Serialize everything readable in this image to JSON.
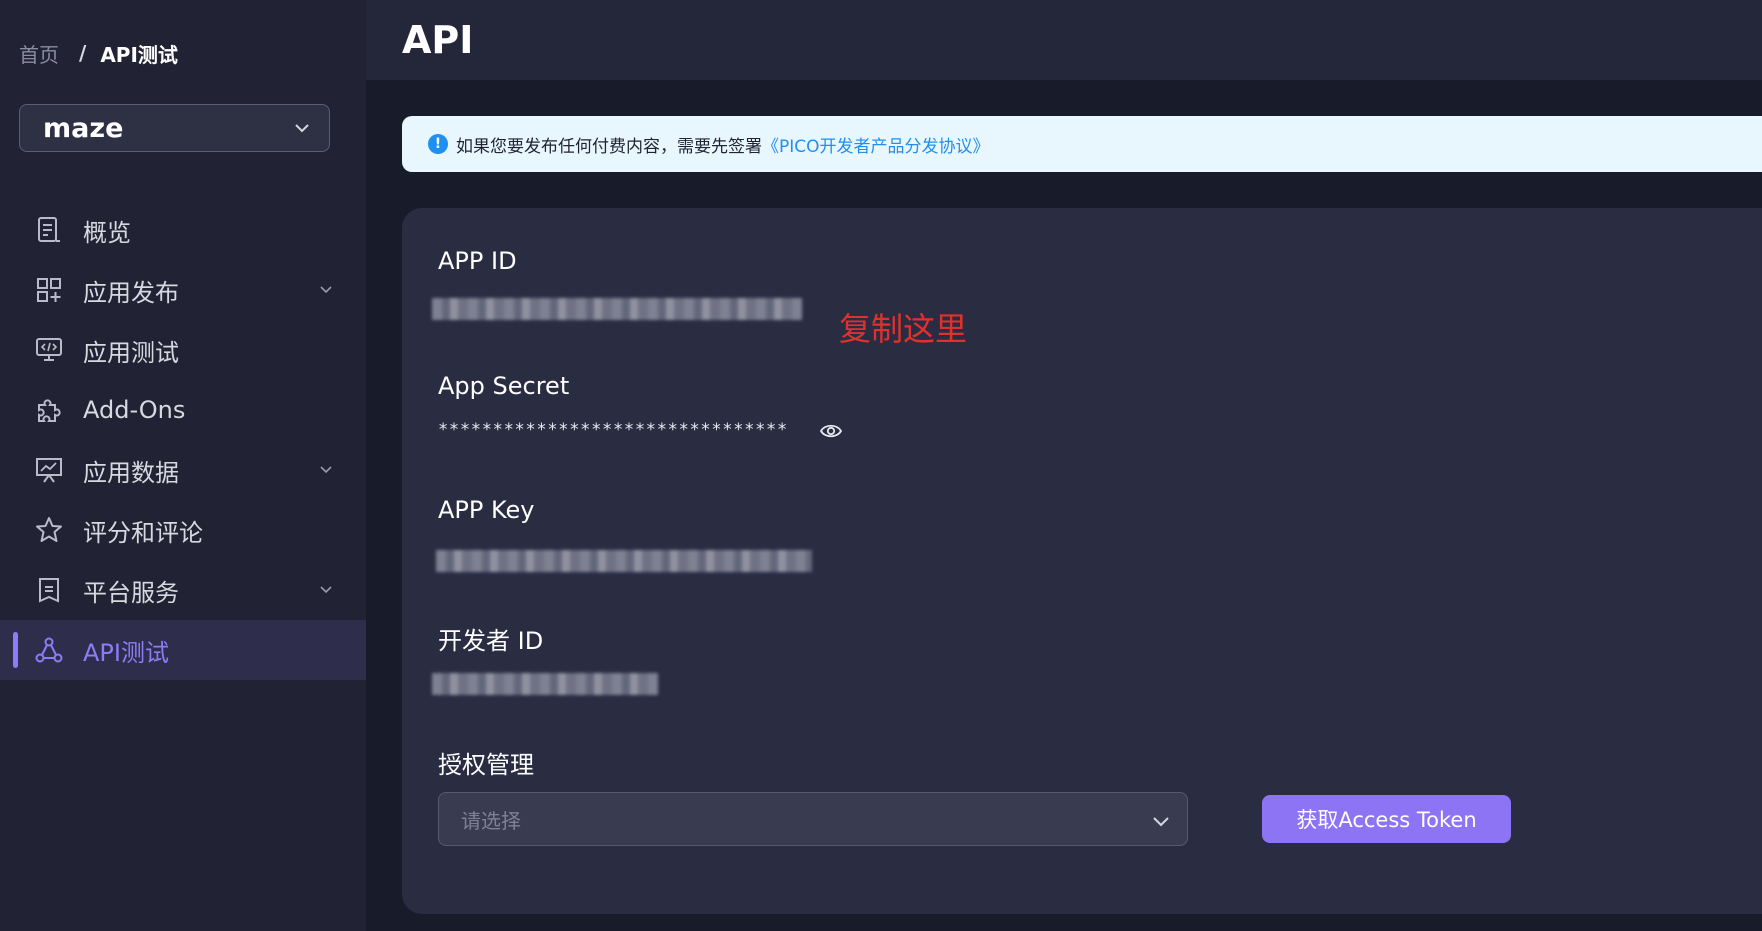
{
  "breadcrumb": {
    "home": "首页",
    "separator": "/",
    "current": "API测试"
  },
  "app_selector": {
    "value": "maze",
    "icon": "chevron-down-icon"
  },
  "sidebar": {
    "items": [
      {
        "label": "概览",
        "icon": "document-list-icon",
        "has_submenu": false,
        "active": false
      },
      {
        "label": "应用发布",
        "icon": "apps-grid-icon",
        "has_submenu": true,
        "active": false
      },
      {
        "label": "应用测试",
        "icon": "monitor-code-icon",
        "has_submenu": false,
        "active": false
      },
      {
        "label": "Add-Ons",
        "icon": "puzzle-icon",
        "has_submenu": false,
        "active": false
      },
      {
        "label": "应用数据",
        "icon": "chart-board-icon",
        "has_submenu": true,
        "active": false
      },
      {
        "label": "评分和评论",
        "icon": "star-icon",
        "has_submenu": false,
        "active": false
      },
      {
        "label": "平台服务",
        "icon": "badge-icon",
        "has_submenu": true,
        "active": false
      },
      {
        "label": "API测试",
        "icon": "api-nodes-icon",
        "has_submenu": false,
        "active": true
      }
    ]
  },
  "header": {
    "title": "API"
  },
  "notice": {
    "icon": "info-icon",
    "text": "如果您要发布任何付费内容，需要先签署",
    "link": "《PICO开发者产品分发协议》"
  },
  "fields": {
    "app_id": {
      "label": "APP ID"
    },
    "app_secret": {
      "label": "App Secret",
      "masked_value": "********************************"
    },
    "app_key": {
      "label": "APP Key"
    },
    "developer_id": {
      "label": "开发者 ID"
    },
    "auth": {
      "label": "授权管理",
      "placeholder": "请选择"
    }
  },
  "annotation": {
    "text": "复制这里"
  },
  "actions": {
    "get_token_label": "获取Access Token"
  },
  "colors": {
    "accent": "#8d74f5",
    "annotation": "#e1312c",
    "link": "#1f8ff0",
    "sidebar_bg": "#212334",
    "card_bg": "#2a2d42"
  }
}
